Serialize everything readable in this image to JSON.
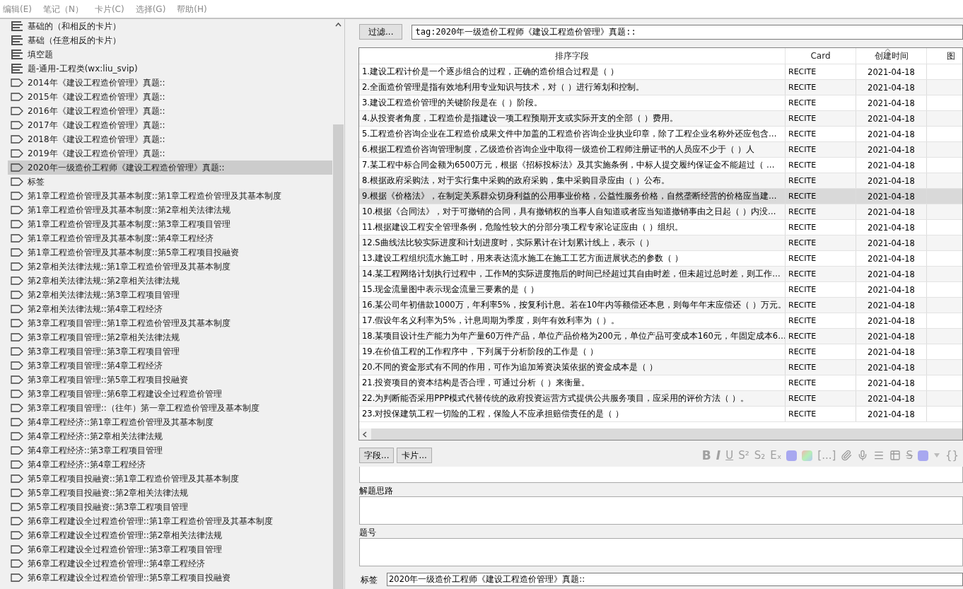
{
  "menu": [
    "编辑(E)",
    "笔记（N）",
    "卡片(C)",
    "选择(G)",
    "帮助(H)"
  ],
  "sidebar": {
    "items": [
      {
        "kind": "note_type",
        "label": "基础的（和相反的卡片）",
        "selected": false
      },
      {
        "kind": "note_type",
        "label": "基础（任意相反的卡片）",
        "selected": false
      },
      {
        "kind": "note_type",
        "label": "填空题",
        "selected": false
      },
      {
        "kind": "note_type",
        "label": "题-通用-工程类(wx:liu_svip)",
        "selected": false
      },
      {
        "kind": "tag",
        "label": "2014年《建设工程造价管理》真题::",
        "selected": false
      },
      {
        "kind": "tag",
        "label": "2015年《建设工程造价管理》真题::",
        "selected": false
      },
      {
        "kind": "tag",
        "label": "2016年《建设工程造价管理》真题::",
        "selected": false
      },
      {
        "kind": "tag",
        "label": "2017年《建设工程造价管理》真题::",
        "selected": false
      },
      {
        "kind": "tag",
        "label": "2018年《建设工程造价管理》真题::",
        "selected": false
      },
      {
        "kind": "tag",
        "label": "2019年《建设工程造价管理》真题::",
        "selected": false
      },
      {
        "kind": "tag",
        "label": "2020年一级造价工程师《建设工程造价管理》真题::",
        "selected": true
      },
      {
        "kind": "tag",
        "label": "标签",
        "selected": false
      },
      {
        "kind": "tag",
        "label": "第1章工程造价管理及其基本制度::第1章工程造价管理及其基本制度",
        "selected": false
      },
      {
        "kind": "tag",
        "label": "第1章工程造价管理及其基本制度::第2章相关法律法规",
        "selected": false
      },
      {
        "kind": "tag",
        "label": "第1章工程造价管理及其基本制度::第3章工程项目管理",
        "selected": false
      },
      {
        "kind": "tag",
        "label": "第1章工程造价管理及其基本制度::第4章工程经济",
        "selected": false
      },
      {
        "kind": "tag",
        "label": "第1章工程造价管理及其基本制度::第5章工程项目投融资",
        "selected": false
      },
      {
        "kind": "tag",
        "label": "第2章相关法律法规::第1章工程造价管理及其基本制度",
        "selected": false
      },
      {
        "kind": "tag",
        "label": "第2章相关法律法规::第2章相关法律法规",
        "selected": false
      },
      {
        "kind": "tag",
        "label": "第2章相关法律法规::第3章工程项目管理",
        "selected": false
      },
      {
        "kind": "tag",
        "label": "第2章相关法律法规::第4章工程经济",
        "selected": false
      },
      {
        "kind": "tag",
        "label": "第3章工程项目管理::第1章工程造价管理及其基本制度",
        "selected": false
      },
      {
        "kind": "tag",
        "label": "第3章工程项目管理::第2章相关法律法规",
        "selected": false
      },
      {
        "kind": "tag",
        "label": "第3章工程项目管理::第3章工程项目管理",
        "selected": false
      },
      {
        "kind": "tag",
        "label": "第3章工程项目管理::第4章工程经济",
        "selected": false
      },
      {
        "kind": "tag",
        "label": "第3章工程项目管理::第5章工程项目投融资",
        "selected": false
      },
      {
        "kind": "tag",
        "label": "第3章工程项目管理::第6章工程建设全过程造价管理",
        "selected": false
      },
      {
        "kind": "tag",
        "label": "第3章工程项目管理::（往年）第一章工程造价管理及基本制度",
        "selected": false
      },
      {
        "kind": "tag",
        "label": "第4章工程经济::第1章工程造价管理及其基本制度",
        "selected": false
      },
      {
        "kind": "tag",
        "label": "第4章工程经济::第2章相关法律法规",
        "selected": false
      },
      {
        "kind": "tag",
        "label": "第4章工程经济::第3章工程项目管理",
        "selected": false
      },
      {
        "kind": "tag",
        "label": "第4章工程经济::第4章工程经济",
        "selected": false
      },
      {
        "kind": "tag",
        "label": "第5章工程项目投融资::第1章工程造价管理及其基本制度",
        "selected": false
      },
      {
        "kind": "tag",
        "label": "第5章工程项目投融资::第2章相关法律法规",
        "selected": false
      },
      {
        "kind": "tag",
        "label": "第5章工程项目投融资::第3章工程项目管理",
        "selected": false
      },
      {
        "kind": "tag",
        "label": "第6章工程建设全过程造价管理::第1章工程造价管理及其基本制度",
        "selected": false
      },
      {
        "kind": "tag",
        "label": "第6章工程建设全过程造价管理::第2章相关法律法规",
        "selected": false
      },
      {
        "kind": "tag",
        "label": "第6章工程建设全过程造价管理::第3章工程项目管理",
        "selected": false
      },
      {
        "kind": "tag",
        "label": "第6章工程建设全过程造价管理::第4章工程经济",
        "selected": false
      },
      {
        "kind": "tag",
        "label": "第6章工程建设全过程造价管理::第5章工程项目投融资",
        "selected": false
      }
    ]
  },
  "filter": {
    "button": "过滤...",
    "value": "tag:2020年一级造价工程师《建设工程造价管理》真题::"
  },
  "table": {
    "columns": [
      {
        "label": "排序字段",
        "sorted": false
      },
      {
        "label": "Card",
        "sorted": false
      },
      {
        "label": "创建时间",
        "sorted": true
      },
      {
        "label": "图",
        "sorted": false
      }
    ],
    "rows": [
      {
        "sort_field": "1.建设工程计价是一个逐步组合的过程，正确的造价组合过程是（ ）",
        "card": "RECITE",
        "created": "2021-04-18",
        "selected": false
      },
      {
        "sort_field": "2.全面造价管理是指有效地利用专业知识与技术，对（ ）进行筹划和控制。",
        "card": "RECITE",
        "created": "2021-04-18",
        "selected": false
      },
      {
        "sort_field": "3.建设工程造价管理的关键阶段是在（ ）阶段。",
        "card": "RECITE",
        "created": "2021-04-18",
        "selected": false
      },
      {
        "sort_field": "4.从投资者角度，工程造价是指建设一项工程预期开支或实际开支的全部（ ）费用。",
        "card": "RECITE",
        "created": "2021-04-18",
        "selected": false
      },
      {
        "sort_field": "5.工程造价咨询企业在工程造价成果文件中加盖的工程造价咨询企业执业印章，除了工程企业名称外还应包含…",
        "card": "RECITE",
        "created": "2021-04-18",
        "selected": false
      },
      {
        "sort_field": "6.根据工程造价咨询管理制度，乙级造价咨询企业中取得一级造价工程师注册证书的人员应不少于（ ）人",
        "card": "RECITE",
        "created": "2021-04-18",
        "selected": false
      },
      {
        "sort_field": "7.某工程中标合同金额为6500万元，根据《招标投标法》及其实施条例，中标人提交履约保证金不能超过（ …",
        "card": "RECITE",
        "created": "2021-04-18",
        "selected": false
      },
      {
        "sort_field": "8.根据政府采购法，对于实行集中采购的政府采购，集中采购目录应由（ ）公布。",
        "card": "RECITE",
        "created": "2021-04-18",
        "selected": false
      },
      {
        "sort_field": "9.根据《价格法》，在制定关系群众切身利益的公用事业价格，公益性服务价格，自然垄断经营的价格应当建…",
        "card": "RECITE",
        "created": "2021-04-18",
        "selected": true
      },
      {
        "sort_field": "10.根据《合同法》，对于可撤销的合同，具有撤销权的当事人自知道或者应当知道撤销事由之日起（ ）内没…",
        "card": "RECITE",
        "created": "2021-04-18",
        "selected": false
      },
      {
        "sort_field": "11.根据建设工程安全管理条例，危险性较大的分部分项工程专家论证应由（ ）组织。",
        "card": "RECITE",
        "created": "2021-04-18",
        "selected": false
      },
      {
        "sort_field": "12.S曲线法比较实际进度和计划进度时，实际累计在计划累计线上，表示（ ）",
        "card": "RECITE",
        "created": "2021-04-18",
        "selected": false
      },
      {
        "sort_field": "13.建设工程组织流水施工时，用来表达流水施工在施工工艺方面进展状态的参数（ ）",
        "card": "RECITE",
        "created": "2021-04-18",
        "selected": false
      },
      {
        "sort_field": "14.某工程网络计划执行过程中，工作M的实际进度拖后的时间已经超过其自由时差，但未超过总时差，则工作…",
        "card": "RECITE",
        "created": "2021-04-18",
        "selected": false
      },
      {
        "sort_field": "15.现金流量图中表示现金流量三要素的是（ ）",
        "card": "RECITE",
        "created": "2021-04-18",
        "selected": false
      },
      {
        "sort_field": "16.某公司年初借款1000万，年利率5%，按复利计息。若在10年内等额偿还本息，则每年年末应偿还（ ）万元。",
        "card": "RECITE",
        "created": "2021-04-18",
        "selected": false
      },
      {
        "sort_field": "17.假设年名义利率为5%，计息周期为季度，则年有效利率为（ ）。",
        "card": "RECITE",
        "created": "2021-04-18",
        "selected": false
      },
      {
        "sort_field": "18.某项目设计生产能力为年产量60万件产品，单位产品价格为200元，单位产品可变成本160元，年固定成本6…",
        "card": "RECITE",
        "created": "2021-04-18",
        "selected": false
      },
      {
        "sort_field": "19.在价值工程的工作程序中，下列属于分析阶段的工作是（ ）",
        "card": "RECITE",
        "created": "2021-04-18",
        "selected": false
      },
      {
        "sort_field": "20.不同的资金形式有不同的作用，可作为追加筹资决策依据的资金成本是（ ）",
        "card": "RECITE",
        "created": "2021-04-18",
        "selected": false
      },
      {
        "sort_field": "21.投资项目的资本结构是否合理，可通过分析（ ）来衡量。",
        "card": "RECITE",
        "created": "2021-04-18",
        "selected": false
      },
      {
        "sort_field": "22.为判断能否采用PPP模式代替传统的政府投资运营方式提供公共服务项目，应采用的评价方法（ ）。",
        "card": "RECITE",
        "created": "2021-04-18",
        "selected": false
      },
      {
        "sort_field": "23.对投保建筑工程一切险的工程，保险人不应承担赔偿责任的是（ ）",
        "card": "RECITE",
        "created": "2021-04-18",
        "selected": false
      }
    ]
  },
  "editor": {
    "buttons": [
      "字段...",
      "卡片..."
    ],
    "toolbar": [
      {
        "kind": "bold",
        "label": "B"
      },
      {
        "kind": "italic",
        "label": "I"
      },
      {
        "kind": "underline",
        "label": "U"
      },
      {
        "kind": "text",
        "label": "S²"
      },
      {
        "kind": "text",
        "label": "S₂"
      },
      {
        "kind": "text",
        "label": "Eₓ"
      },
      {
        "kind": "swatch",
        "color": "#a8a8f0"
      },
      {
        "kind": "gradient"
      },
      {
        "kind": "text",
        "label": "[...]"
      },
      {
        "kind": "paperclip"
      },
      {
        "kind": "mic"
      },
      {
        "kind": "lines"
      },
      {
        "kind": "table"
      },
      {
        "kind": "strike",
        "label": "S"
      },
      {
        "kind": "swatch",
        "color": "#a8a8f0"
      },
      {
        "kind": "caret"
      },
      {
        "kind": "text",
        "label": "{}"
      }
    ],
    "fields": [
      {
        "label": "解题思路"
      },
      {
        "label": "题号"
      }
    ],
    "tags_label": "标签",
    "tags_value": "2020年一级造价工程师《建设工程造价管理》真题::"
  }
}
